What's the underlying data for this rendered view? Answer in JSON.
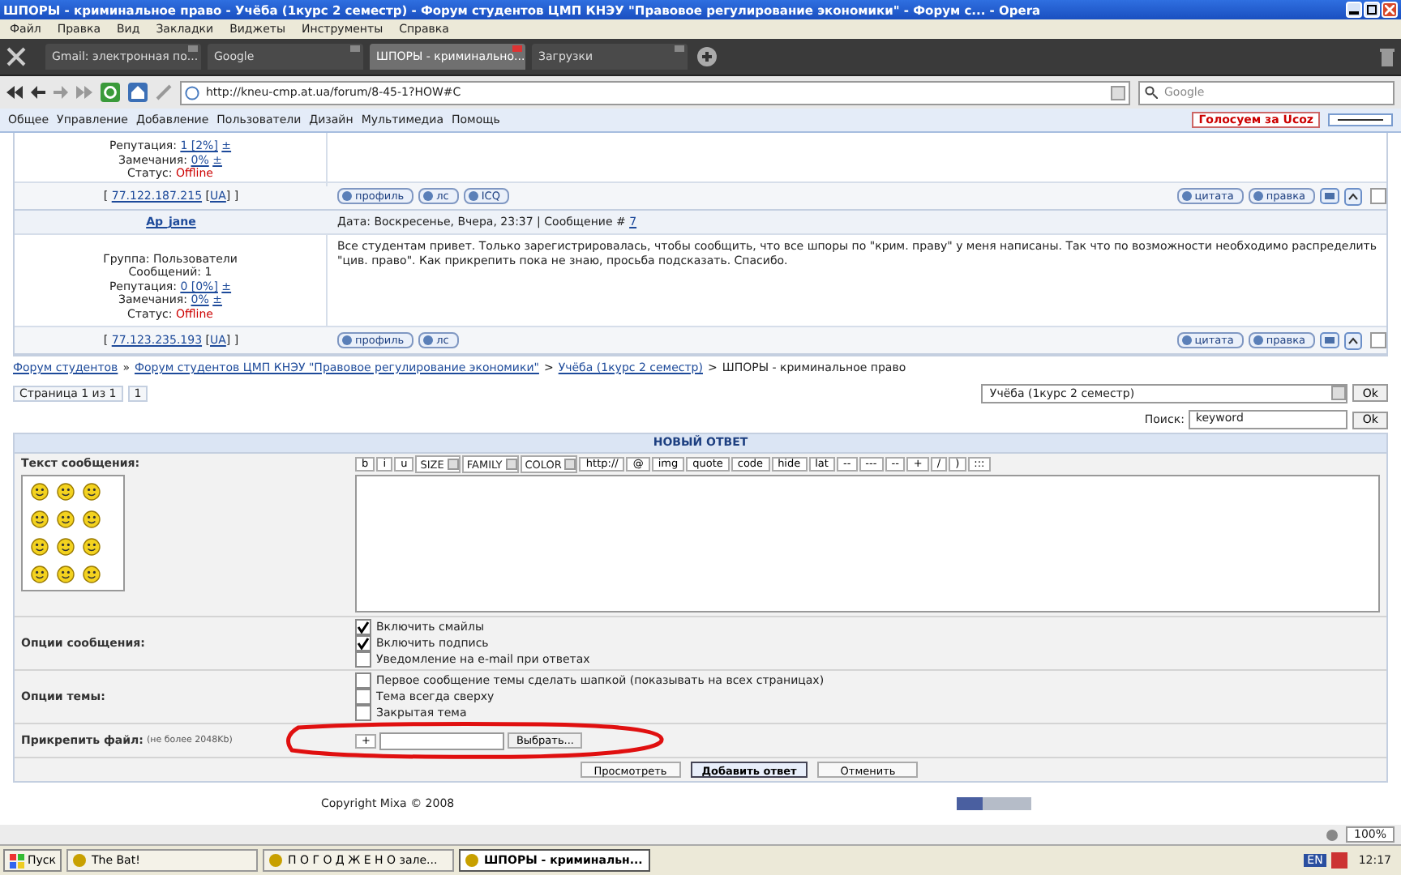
{
  "window": {
    "title": "ШПОРЫ - криминальное право - Учёба (1курс 2 семестр) - Форум студентов ЦМП КНЭУ \"Правовое регулирование экономики\" - Форум с... - Opera"
  },
  "menu": [
    "Файл",
    "Правка",
    "Вид",
    "Закладки",
    "Виджеты",
    "Инструменты",
    "Справка"
  ],
  "tabs": [
    {
      "label": "Gmail: электронная по...",
      "selected": false
    },
    {
      "label": "Google",
      "selected": false
    },
    {
      "label": "ШПОРЫ - криминально...",
      "selected": true
    },
    {
      "label": "Загрузки",
      "selected": false
    }
  ],
  "address": {
    "value": "http://kneu-cmp.at.ua/forum/8-45-1?HOW#C"
  },
  "web_search": {
    "placeholder": "Google"
  },
  "ucoz_panel": {
    "items": [
      "Общее",
      "Управление",
      "Добавление",
      "Пользователи",
      "Дизайн",
      "Мультимедиа",
      "Помощь"
    ],
    "vote": "Голосуем за Ucoz"
  },
  "posts": [
    {
      "rep_label": "Репутация:",
      "reputation": "1 [2%]",
      "rep_vote": "±",
      "remarks_label": "Замечания:",
      "remarks": "0%",
      "remarks_vote": "±",
      "status_label": "Статус:",
      "status": "Offline",
      "ip_open": "[",
      "ip": "77.122.187.215",
      "country_open": "[",
      "country": "UA",
      "ip_close": "] ]",
      "buttons": [
        "профиль",
        "лс",
        "ICQ"
      ],
      "actions": [
        "цитата",
        "правка"
      ],
      "checked": false
    },
    {
      "author": "Ap_jane",
      "header": "Дата: Воскресенье, Вчера, 23:37 | Сообщение #",
      "number": "7",
      "info": [
        "Группа: Пользователи",
        "Сообщений: 1"
      ],
      "rep_label": "Репутация:",
      "reputation": "0 [0%]",
      "rep_vote": "±",
      "remarks_label": "Замечания:",
      "remarks": "0%",
      "remarks_vote": "±",
      "status_label": "Статус:",
      "status": "Offline",
      "checked": false,
      "body": "Все студентам привет. Только зарегистрировалась, чтобы сообщить, что все шпоры по \"крим. праву\" у меня написаны. Так что по возможности необходимо распределить \"цив. право\". Как прикрепить пока не знаю, просьба подсказать. Спасибо.",
      "ip_open": "[",
      "ip": "77.123.235.193",
      "country_open": "[",
      "country": "UA",
      "ip_close": "] ]",
      "buttons": [
        "профиль",
        "лс"
      ],
      "actions": [
        "цитата",
        "правка"
      ]
    }
  ],
  "breadcrumb": [
    {
      "kind": "link",
      "text": "Форум студентов"
    },
    {
      "kind": "sep",
      "text": "»"
    },
    {
      "kind": "link",
      "text": "Форум студентов ЦМП КНЭУ \"Правовое регулирование экономики\""
    },
    {
      "kind": "sep",
      "text": ">"
    },
    {
      "kind": "link",
      "text": "Учёба (1курс 2 семестр)"
    },
    {
      "kind": "sep",
      "text": ">"
    },
    {
      "kind": "current",
      "text": "ШПОРЫ - криминальное право"
    }
  ],
  "pager": {
    "label": "Страница 1 из 1",
    "page": "1"
  },
  "jump": {
    "value": "Учёба (1курс 2 семестр)",
    "button": "Ok"
  },
  "forum_search": {
    "label": "Поиск:",
    "value": "keyword",
    "button": "Ok"
  },
  "reply": {
    "title": "НОВЫЙ ОТВЕТ",
    "text_label": "Текст сообщения:",
    "format_buttons": [
      "b",
      "i",
      "u"
    ],
    "selects": [
      "SIZE",
      "FAMILY",
      "COLOR"
    ],
    "tag_buttons": [
      "http://",
      "@",
      "img",
      "quote",
      "code",
      "hide",
      "lat",
      "--",
      "---",
      "--",
      "+",
      "/",
      ")",
      ":::"
    ],
    "options_label": "Опции сообщения:",
    "options": [
      {
        "label": "Включить смайлы",
        "checked": true
      },
      {
        "label": "Включить подпись",
        "checked": true
      },
      {
        "label": "Уведомление на e-mail при ответах",
        "checked": false
      }
    ],
    "topic_label": "Опции темы:",
    "topic_options": [
      {
        "label": "Первое сообщение темы сделать шапкой (показывать на всех страницах)",
        "checked": false
      },
      {
        "label": "Тема всегда сверху",
        "checked": false
      },
      {
        "label": "Закрытая тема",
        "checked": false
      }
    ],
    "attach_label": "Прикрепить файл:",
    "attach_hint": "(не более 2048Kb)",
    "attach_add": "+",
    "attach_browse": "Выбрать...",
    "buttons": [
      {
        "label": "Просмотреть",
        "kind": "normal"
      },
      {
        "label": "Добавить ответ",
        "kind": "primary"
      },
      {
        "label": "Отменить",
        "kind": "normal"
      }
    ]
  },
  "copyright": "Copyright Mixa © 2008",
  "status_bar": {
    "zoom": "100%"
  },
  "taskbar": {
    "start": "Пуск",
    "items": [
      {
        "label": "The Bat!",
        "selected": false
      },
      {
        "label": "П О Г О Д Ж Е Н О зале...",
        "selected": false
      },
      {
        "label": "ШПОРЫ - криминальн...",
        "selected": true
      }
    ],
    "lang": "EN",
    "clock": "12:17"
  }
}
